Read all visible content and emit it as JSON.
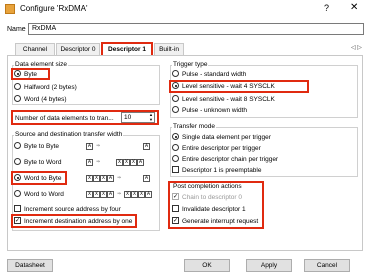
{
  "window": {
    "title": "Configure 'RxDMA'",
    "help": "?",
    "close": "✕"
  },
  "name_field": {
    "label": "Name",
    "value": "RxDMA"
  },
  "tabs": [
    {
      "label": "Channel"
    },
    {
      "label": "Descriptor 0"
    },
    {
      "label": "Descriptor 1"
    },
    {
      "label": "Built-in"
    }
  ],
  "tab_scroll": "◁ ▷",
  "data_element_size": {
    "title": "Data element size",
    "options": [
      "Byte",
      "Halfword (2 bytes)",
      "Word (4 bytes)"
    ],
    "selected": "Byte"
  },
  "num_elements": {
    "label": "Number of data elements to tran...",
    "value": "10"
  },
  "source_dest_width": {
    "title": "Source and destination transfer width",
    "options": [
      "Byte to Byte",
      "Byte to Word",
      "Word to Byte",
      "Word to Word"
    ],
    "selected": "Word to Byte"
  },
  "diagram_cells": {
    "a": "A",
    "x": "X"
  },
  "increment_source": {
    "label": "Increment source address by four",
    "checked": false
  },
  "increment_dest": {
    "label": "Increment destination address by one",
    "checked": true
  },
  "trigger_type": {
    "title": "Trigger type",
    "options": [
      "Pulse - standard width",
      "Level sensitive - wait 4 SYSCLK",
      "Level sensitive - wait 8 SYSCLK",
      "Pulse - unknown width"
    ],
    "selected": "Level sensitive - wait 4 SYSCLK"
  },
  "transfer_mode": {
    "title": "Transfer mode",
    "options": [
      "Single data element per trigger",
      "Entire descriptor per trigger",
      "Entire descriptor chain per trigger"
    ],
    "selected": "Single data element per trigger",
    "preemptable": {
      "label": "Descriptor 1 is preemptable",
      "checked": false
    }
  },
  "post_completion": {
    "title": "Post completion actions",
    "items": [
      {
        "label": "Chain to descriptor 0",
        "checked": true,
        "disabled": true
      },
      {
        "label": "Invalidate descriptor 1",
        "checked": false,
        "disabled": false
      },
      {
        "label": "Generate interrupt request",
        "checked": true,
        "disabled": false
      }
    ]
  },
  "buttons": {
    "datasheet": "Datasheet",
    "ok": "OK",
    "apply": "Apply",
    "cancel": "Cancel"
  }
}
